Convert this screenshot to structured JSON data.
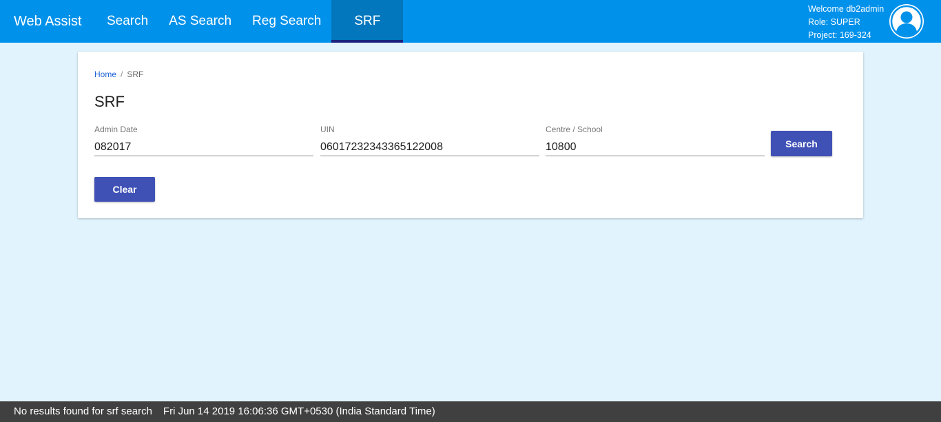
{
  "header": {
    "brand": "Web Assist",
    "nav": [
      {
        "label": "Search"
      },
      {
        "label": "AS Search"
      },
      {
        "label": "Reg Search"
      },
      {
        "label": "SRF"
      }
    ],
    "user": {
      "welcome": "Welcome db2admin",
      "role": "Role: SUPER",
      "project": "Project: 169-324"
    },
    "avatar_icon": "user-avatar-icon"
  },
  "breadcrumb": {
    "home": "Home",
    "separator": "/",
    "current": "SRF"
  },
  "page_title": "SRF",
  "form": {
    "admin_date": {
      "label": "Admin Date",
      "value": "082017"
    },
    "uin": {
      "label": "UIN",
      "value": "06017232343365122008"
    },
    "centre": {
      "label": "Centre / School",
      "value": "10800"
    },
    "search_label": "Search",
    "clear_label": "Clear"
  },
  "status": {
    "message": "No results found for srf search",
    "timestamp": "Fri Jun 14 2019 16:06:36 GMT+0530 (India Standard Time)"
  },
  "colors": {
    "topbar": "#0091ea",
    "active_tab": "#0277bd",
    "active_underline": "#1a237e",
    "button": "#3f51b5",
    "page_bg": "#e1f3fd",
    "status_bar": "#404040"
  }
}
